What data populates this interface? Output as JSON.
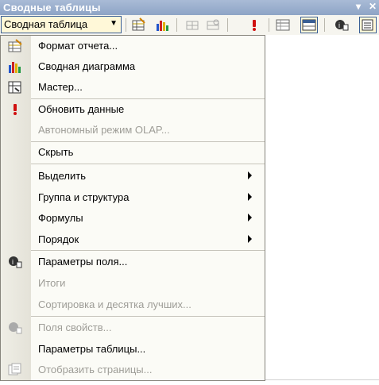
{
  "window": {
    "title": "Сводные таблицы"
  },
  "toolbar": {
    "dropdown_label": "Сводная таблица",
    "icons": [
      "report-format-icon",
      "pivot-chart-icon",
      "hide-detail-icon",
      "show-detail-icon",
      "refresh-icon",
      "field-list-icon",
      "table-options-icon",
      "field-settings-icon",
      "show-pages-icon"
    ]
  },
  "menu": {
    "items": [
      {
        "label": "Формат отчета...",
        "icon": "report-format-icon",
        "enabled": true,
        "submenu": false
      },
      {
        "label": "Сводная диаграмма",
        "icon": "pivot-chart-icon",
        "enabled": true,
        "submenu": false
      },
      {
        "label": "Мастер...",
        "icon": "wizard-icon",
        "enabled": true,
        "submenu": false
      },
      {
        "label": "Обновить данные",
        "icon": "refresh-icon",
        "enabled": true,
        "submenu": false
      },
      {
        "label": "Автономный режим OLAP...",
        "icon": "",
        "enabled": false,
        "submenu": false
      },
      {
        "label": "Скрыть",
        "icon": "",
        "enabled": true,
        "submenu": false
      },
      {
        "label": "Выделить",
        "icon": "",
        "enabled": true,
        "submenu": true
      },
      {
        "label": "Группа и структура",
        "icon": "",
        "enabled": true,
        "submenu": true
      },
      {
        "label": "Формулы",
        "icon": "",
        "enabled": true,
        "submenu": true
      },
      {
        "label": "Порядок",
        "icon": "",
        "enabled": true,
        "submenu": true
      },
      {
        "label": "Параметры поля...",
        "icon": "field-settings-icon",
        "enabled": true,
        "submenu": false
      },
      {
        "label": "Итоги",
        "icon": "",
        "enabled": false,
        "submenu": false
      },
      {
        "label": "Сортировка и десятка лучших...",
        "icon": "",
        "enabled": false,
        "submenu": false
      },
      {
        "label": "Поля свойств...",
        "icon": "property-fields-icon",
        "enabled": false,
        "submenu": false
      },
      {
        "label": "Параметры таблицы...",
        "icon": "",
        "enabled": true,
        "submenu": false
      },
      {
        "label": "Отобразить страницы...",
        "icon": "show-pages-icon",
        "enabled": false,
        "submenu": false
      }
    ]
  },
  "colors": {
    "accent": "#3a5f95",
    "highlight": "#fff8d8",
    "title_bar": "#99acc9",
    "disabled_text": "#9e9d97"
  }
}
